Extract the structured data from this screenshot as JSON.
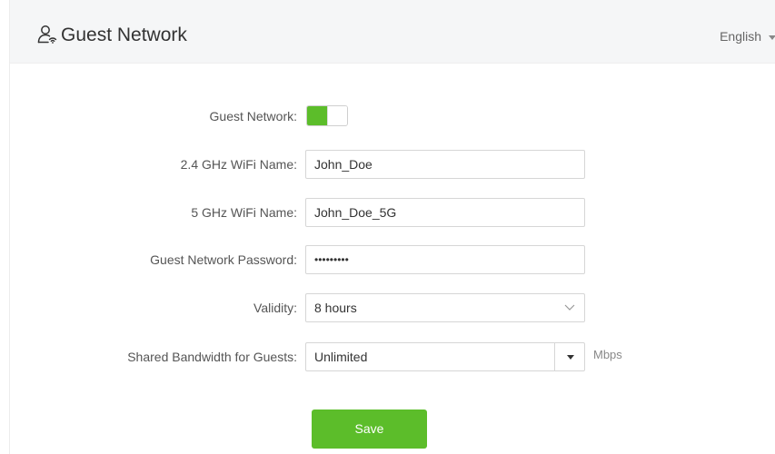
{
  "header": {
    "title": "Guest Network",
    "icon": "guest-user-icon",
    "language": "English"
  },
  "form": {
    "guest_network": {
      "label": "Guest Network:",
      "enabled": true
    },
    "wifi_24_name": {
      "label": "2.4 GHz WiFi Name:",
      "value": "John_Doe"
    },
    "wifi_5_name": {
      "label": "5 GHz WiFi Name:",
      "value": "John_Doe_5G"
    },
    "password": {
      "label": "Guest Network Password:",
      "value": "•••••••••"
    },
    "validity": {
      "label": "Validity:",
      "value": "8 hours"
    },
    "bandwidth": {
      "label": "Shared Bandwidth for Guests:",
      "value": "Unlimited",
      "unit": "Mbps"
    }
  },
  "actions": {
    "save_label": "Save"
  },
  "colors": {
    "accent": "#5cbd2a",
    "header_bg": "#f5f6f7"
  }
}
